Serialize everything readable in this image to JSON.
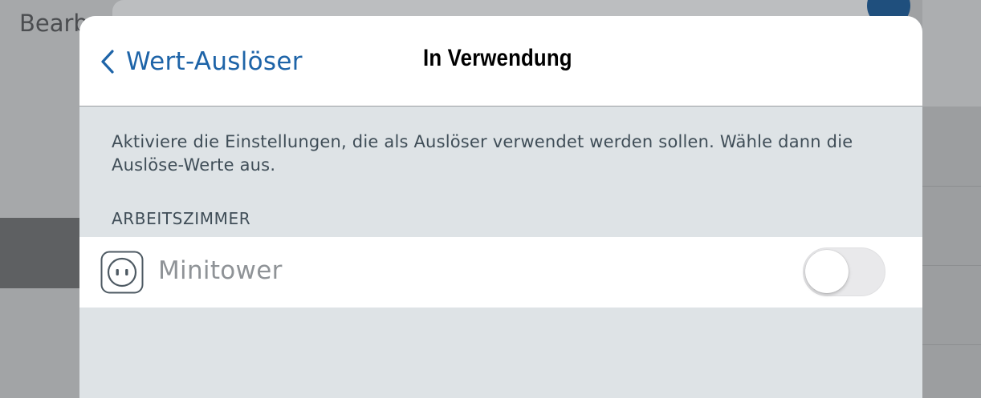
{
  "background": {
    "title": "Bearb"
  },
  "navbar": {
    "back_label": "Wert-Auslöser",
    "back_icon": "chevron-left-icon",
    "title": "In Verwendung"
  },
  "description": "Aktiviere die Einstellungen, die als Auslöser verwendet werden sollen. Wähle dann die Auslöse-Werte aus.",
  "section": {
    "header": "ARBEITSZIMMER",
    "rows": [
      {
        "icon": "power-outlet-icon",
        "label": "Minitower",
        "toggle_on": false
      }
    ]
  },
  "colors": {
    "accent": "#1e64a8",
    "sheet_background": "#dee3e6",
    "secondary_text": "#3f4d57",
    "disabled_text": "#8f9397",
    "toggle_off": "#e9e9eb"
  }
}
